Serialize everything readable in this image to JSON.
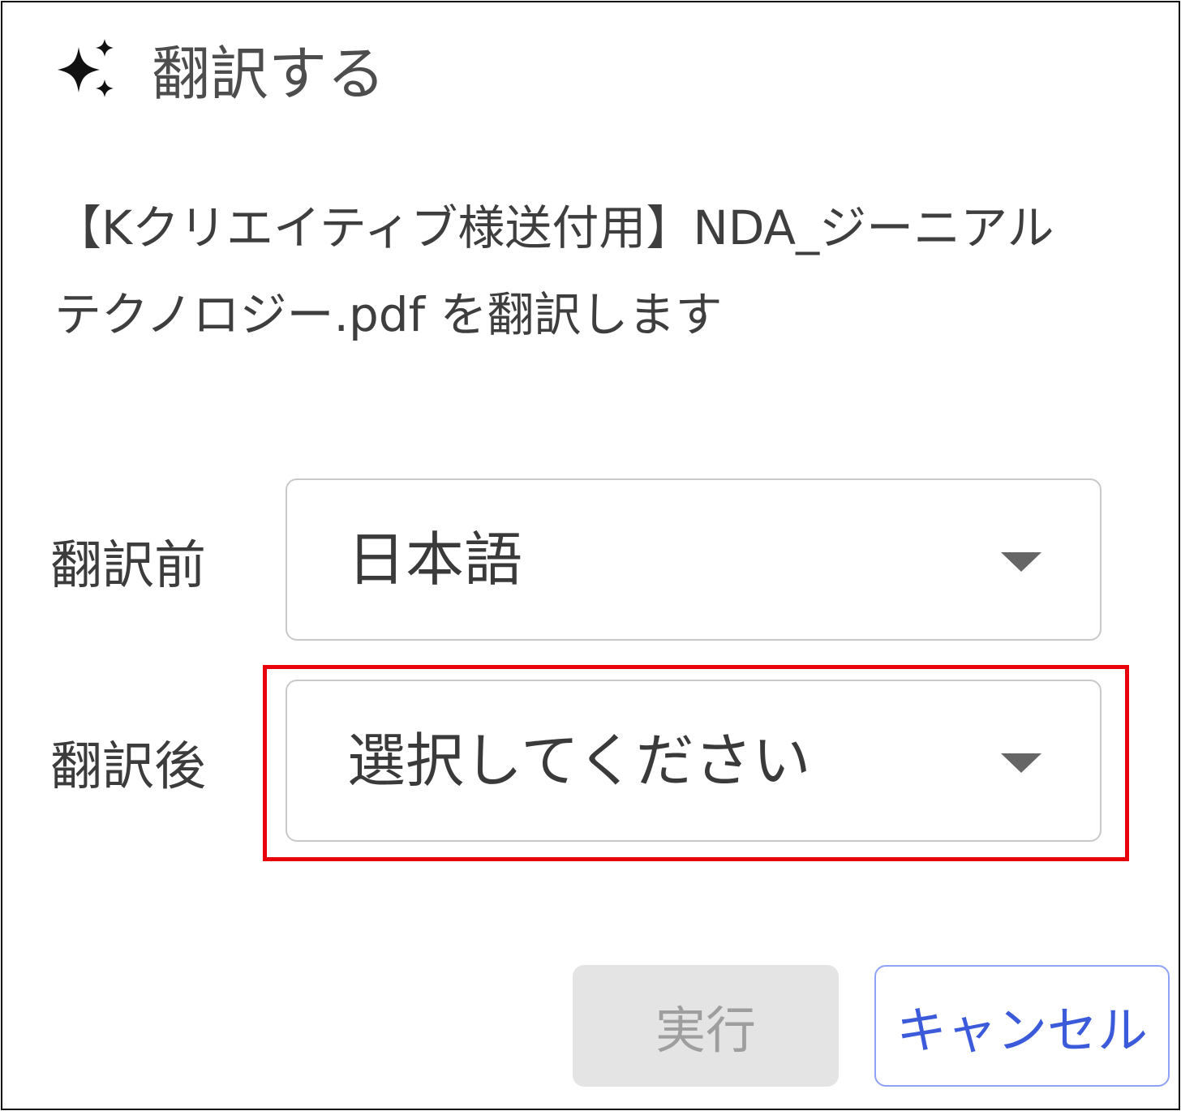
{
  "dialog": {
    "title": "翻訳する",
    "icon": "sparkle-icon",
    "description": "【Kクリエイティブ様送付用】NDA_ジーニアルテクノロジー.pdf を翻訳します"
  },
  "fields": {
    "source": {
      "label": "翻訳前",
      "value": "日本語"
    },
    "target": {
      "label": "翻訳後",
      "value": "選択してください"
    }
  },
  "buttons": {
    "execute_label": "実行",
    "cancel_label": "キャンセル"
  },
  "colors": {
    "highlight": "#e8000b",
    "cancel_text": "#3b5bdb",
    "execute_bg": "#e4e4e4"
  }
}
